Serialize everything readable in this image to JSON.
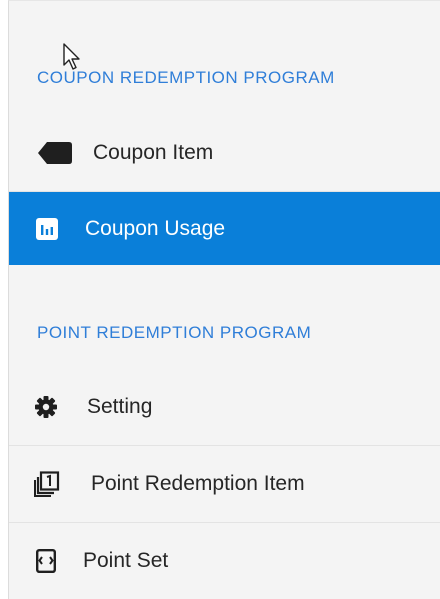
{
  "sidebar": {
    "sections": [
      {
        "title": "COUPON REDEMPTION PROGRAM",
        "items": [
          {
            "label": "Coupon Item",
            "icon": "tag-icon",
            "active": false
          },
          {
            "label": "Coupon Usage",
            "icon": "bar-chart-icon",
            "active": true
          }
        ]
      },
      {
        "title": "POINT REDEMPTION PROGRAM",
        "items": [
          {
            "label": "Setting",
            "icon": "gear-icon",
            "active": false
          },
          {
            "label": "Point Redemption Item",
            "icon": "stacked-pages-icon",
            "active": false
          },
          {
            "label": "Point Set",
            "icon": "point-set-icon",
            "active": false
          }
        ]
      }
    ]
  },
  "colors": {
    "sidebar_background": "#f4f4f4",
    "section_title": "#2f7ed8",
    "active_background": "#0a7fd9",
    "active_text": "#ffffff",
    "item_text": "#262626"
  }
}
